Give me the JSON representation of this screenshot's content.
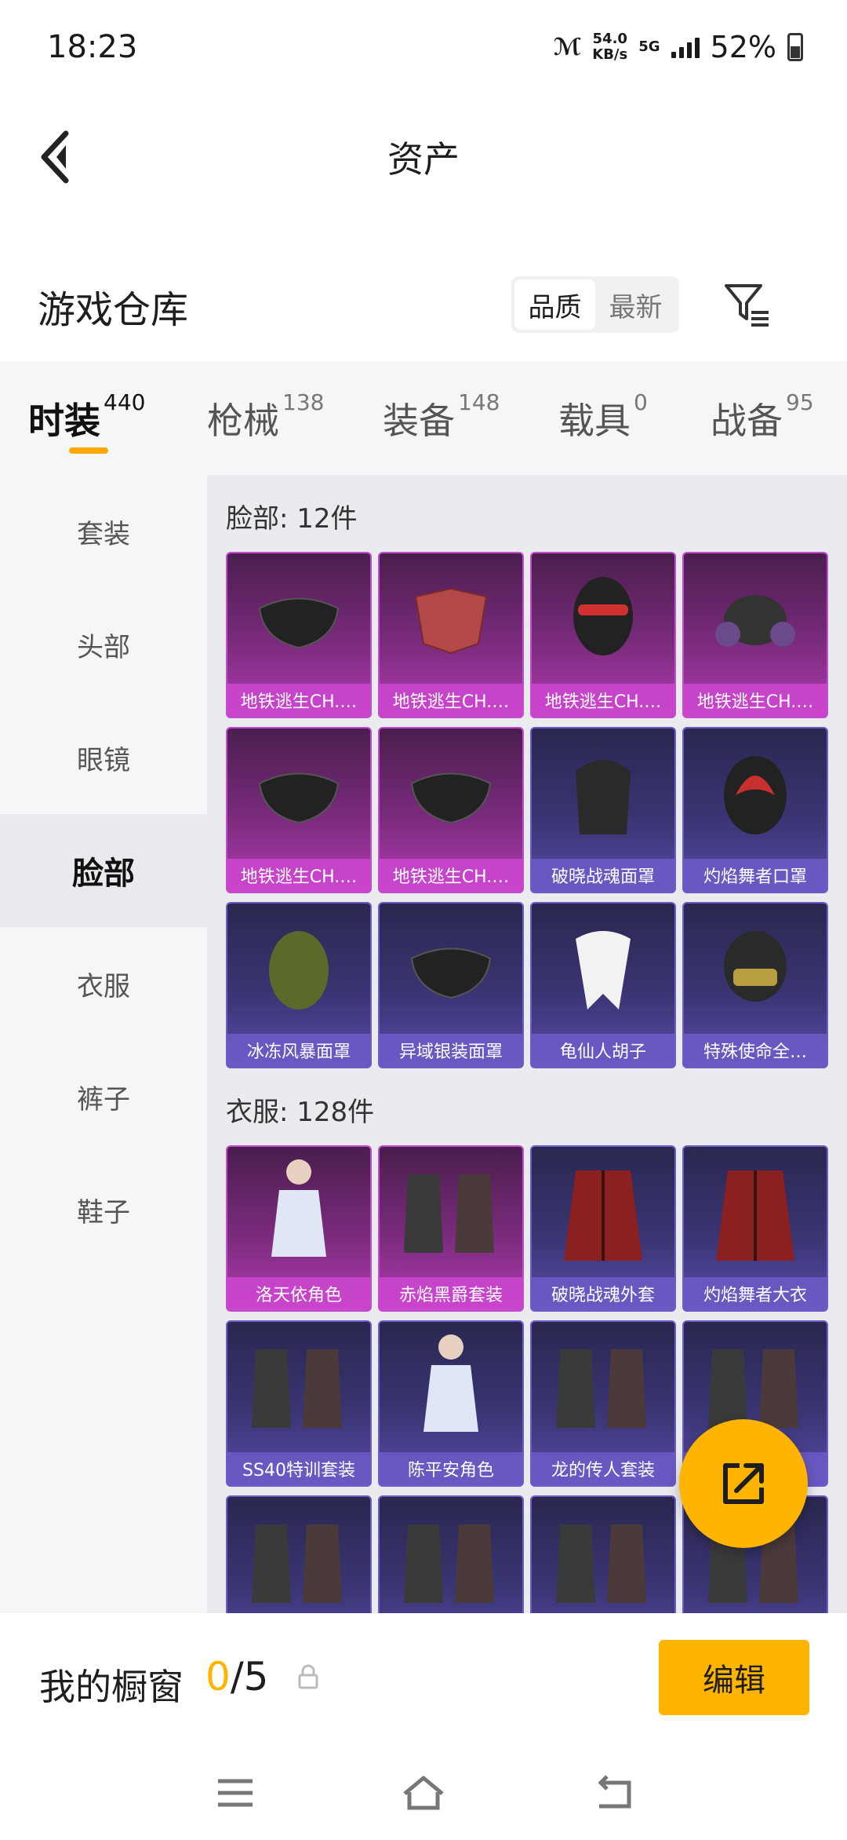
{
  "status_bar": {
    "time": "18:23",
    "net_speed_value": "54.0",
    "net_speed_unit": "KB/s",
    "network_type": "5G",
    "battery": "52%"
  },
  "header": {
    "title": "资产"
  },
  "warehouse": {
    "title": "游戏仓库",
    "sort_options": [
      "品质",
      "最新"
    ],
    "active_sort": "品质"
  },
  "tabs": [
    {
      "label": "时装",
      "count": "440",
      "active": true
    },
    {
      "label": "枪械",
      "count": "138"
    },
    {
      "label": "装备",
      "count": "148"
    },
    {
      "label": "载具",
      "count": "0"
    },
    {
      "label": "战备",
      "count": "95"
    }
  ],
  "sidebar": {
    "items": [
      "套装",
      "头部",
      "眼镜",
      "脸部",
      "衣服",
      "裤子",
      "鞋子"
    ],
    "active": "脸部"
  },
  "sections": [
    {
      "title": "脸部: 12件",
      "items": [
        {
          "name": "地铁逃生CH.…",
          "tier": "purple",
          "icon": "mask-icon"
        },
        {
          "name": "地铁逃生CH.…",
          "tier": "purple",
          "icon": "bandana-icon"
        },
        {
          "name": "地铁逃生CH.…",
          "tier": "purple",
          "icon": "balaclava-icon"
        },
        {
          "name": "地铁逃生CH.…",
          "tier": "purple",
          "icon": "gas-mask-icon"
        },
        {
          "name": "地铁逃生CH.…",
          "tier": "purple",
          "icon": "mask-icon"
        },
        {
          "name": "地铁逃生CH.…",
          "tier": "purple",
          "icon": "mask-icon"
        },
        {
          "name": "破晓战魂面罩",
          "tier": "blue",
          "icon": "face-shield-icon"
        },
        {
          "name": "灼焰舞者口罩",
          "tier": "blue",
          "icon": "flame-mask-icon"
        },
        {
          "name": "冰冻风暴面罩",
          "tier": "blue",
          "icon": "scarf-icon"
        },
        {
          "name": "异域银装面罩",
          "tier": "blue",
          "icon": "mask-icon"
        },
        {
          "name": "龟仙人胡子",
          "tier": "blue",
          "icon": "beard-icon"
        },
        {
          "name": "特殊使命全…",
          "tier": "blue",
          "icon": "helmet-icon"
        }
      ]
    },
    {
      "title": "衣服: 128件",
      "items": [
        {
          "name": "洛天依角色",
          "tier": "purple",
          "icon": "character-icon"
        },
        {
          "name": "赤焰黑爵套装",
          "tier": "purple",
          "icon": "outfit-icon"
        },
        {
          "name": "破晓战魂外套",
          "tier": "blue",
          "icon": "coat-icon"
        },
        {
          "name": "灼焰舞者大衣",
          "tier": "blue",
          "icon": "coat-icon"
        },
        {
          "name": "SS40特训套装",
          "tier": "blue",
          "icon": "outfit-icon"
        },
        {
          "name": "陈平安角色",
          "tier": "blue",
          "icon": "character-icon"
        },
        {
          "name": "龙的传人套装",
          "tier": "blue",
          "icon": "outfit-icon"
        },
        {
          "name": "装",
          "tier": "blue",
          "icon": "outfit-icon"
        },
        {
          "name": "",
          "tier": "blue",
          "icon": "outfit-icon"
        },
        {
          "name": "",
          "tier": "blue",
          "icon": "outfit-icon"
        },
        {
          "name": "",
          "tier": "blue",
          "icon": "outfit-icon"
        },
        {
          "name": "",
          "tier": "blue",
          "icon": "outfit-icon"
        }
      ]
    }
  ],
  "bottom_bar": {
    "window_label": "我的橱窗",
    "current": "0",
    "separator_total": "/5",
    "edit_label": "编辑"
  },
  "colors": {
    "accent": "#ffb400",
    "purple_tier": "#b13cb2",
    "blue_tier": "#584aa9"
  }
}
